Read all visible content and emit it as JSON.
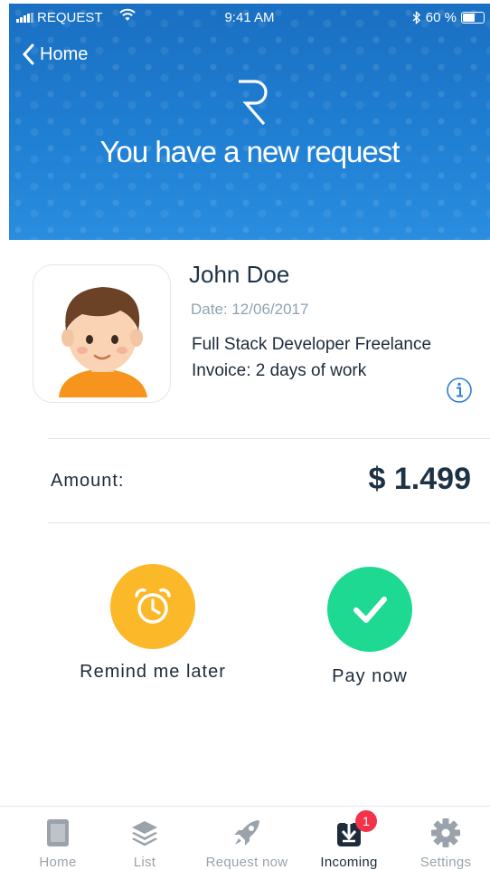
{
  "status_bar": {
    "carrier": "REQUEST",
    "time": "9:41 AM",
    "battery": "60 %",
    "battery_level": 0.6
  },
  "header": {
    "back_label": "Home",
    "title": "You have a new request"
  },
  "request": {
    "name": "John Doe",
    "date": "Date: 12/06/2017",
    "description_line1": "Full Stack Developer Freelance",
    "description_line2": "Invoice: 2 days of work"
  },
  "amount": {
    "label": "Amount:",
    "value": "$ 1.499"
  },
  "actions": {
    "remind_label": "Remind me later",
    "pay_label": "Pay now"
  },
  "colors": {
    "header_blue": "#1f7fd3",
    "remind_orange": "#fbb829",
    "pay_green": "#1ed992",
    "badge_red": "#f2344a"
  },
  "tabbar": {
    "items": [
      {
        "label": "Home",
        "icon": "document-icon"
      },
      {
        "label": "List",
        "icon": "layers-icon"
      },
      {
        "label": "Request now",
        "icon": "rocket-icon"
      },
      {
        "label": "Incoming",
        "icon": "download-icon",
        "badge": "1",
        "active": true
      },
      {
        "label": "Settings",
        "icon": "gear-icon"
      }
    ]
  }
}
